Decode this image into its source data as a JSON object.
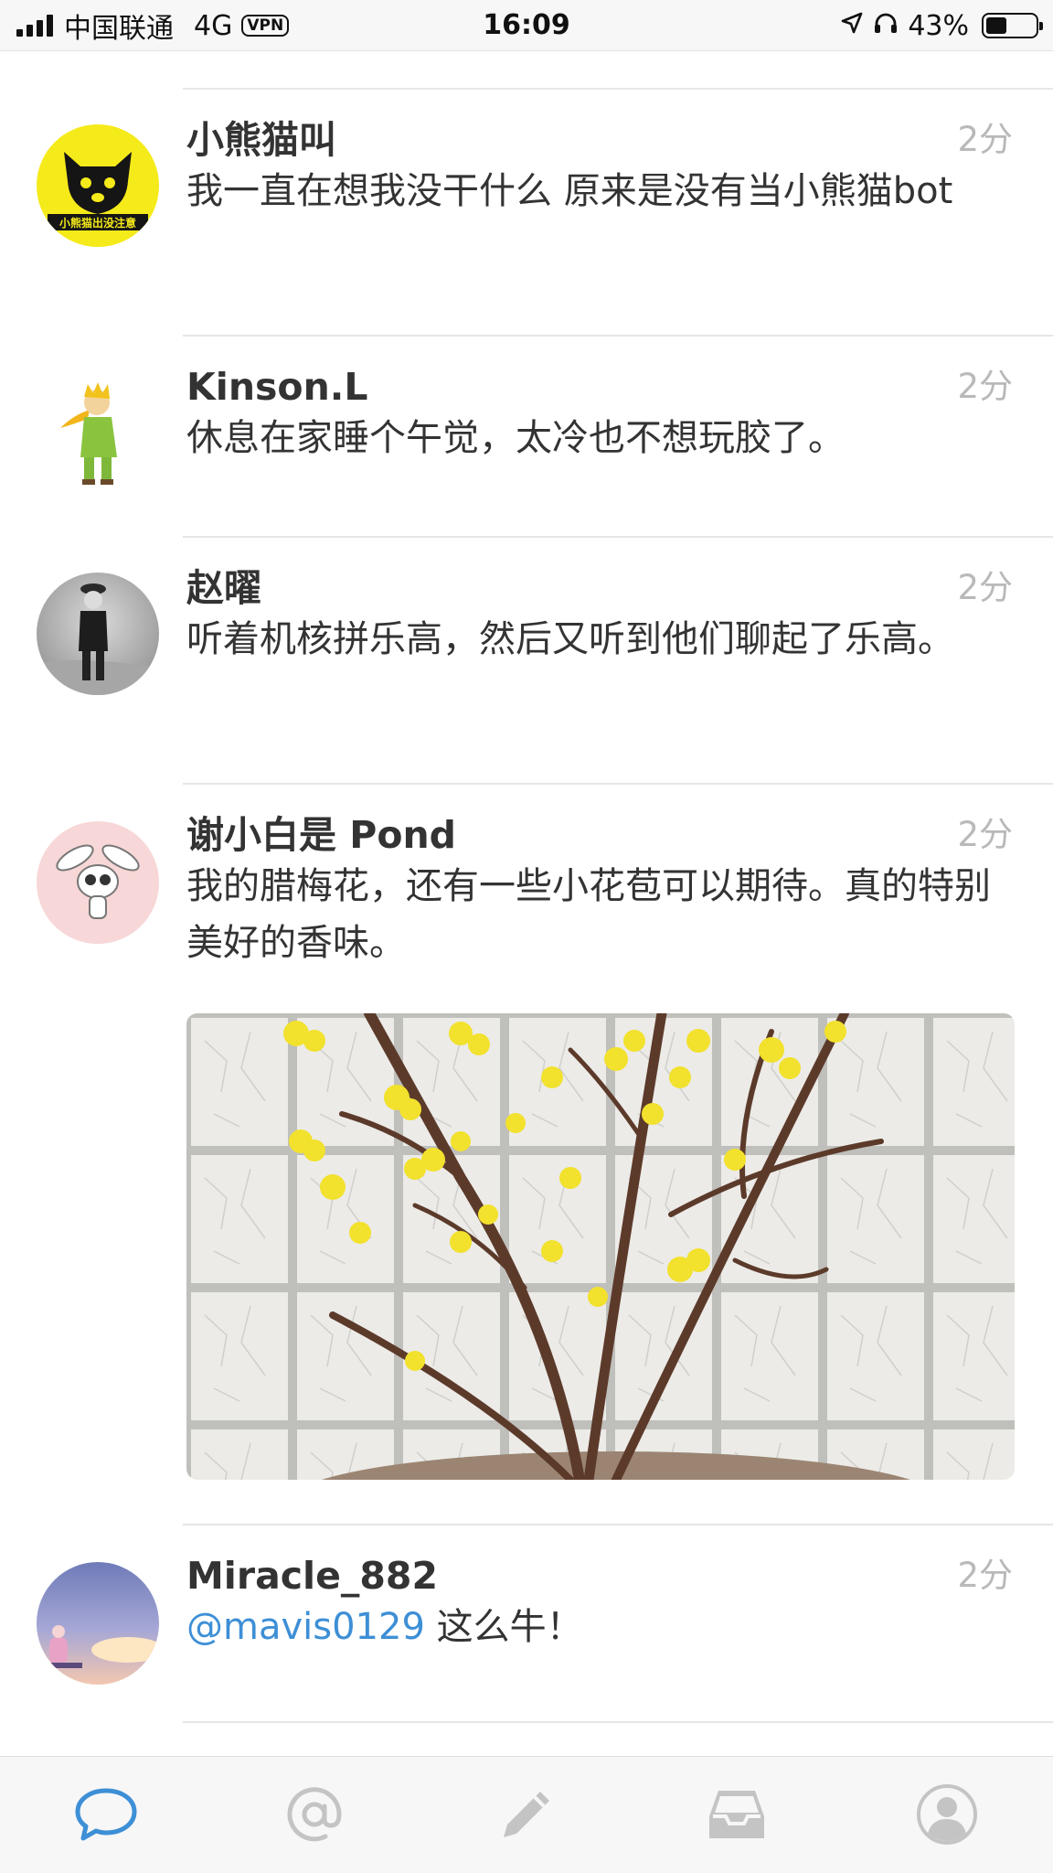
{
  "status_bar": {
    "carrier": "中国联通",
    "network": "4G",
    "vpn": "VPN",
    "time": "16:09",
    "battery": "43%",
    "battery_level": 0.43
  },
  "feed": {
    "posts": [
      {
        "author": "小熊猫叫",
        "time": "2分",
        "content": "我一直在想我没干什么 原来是没有当小熊猫bot",
        "avatar_icon": "red-panda-avatar",
        "avatar_text": "小熊猫出没注意"
      },
      {
        "author": "Kinson.L",
        "time": "2分",
        "content": "休息在家睡个午觉，太冷也不想玩胶了。",
        "avatar_icon": "little-prince-avatar"
      },
      {
        "author": "赵曜",
        "time": "2分",
        "content": "听着机核拼乐高，然后又听到他们聊起了乐高。",
        "avatar_icon": "vintage-photo-avatar"
      },
      {
        "author": "谢小白是 Pond",
        "time": "2分",
        "content": "我的腊梅花，还有一些小花苞可以期待。真的特别美好的香味。",
        "avatar_icon": "rabbit-avatar",
        "image": "wintersweet-photo"
      },
      {
        "author": "Miracle_882",
        "time": "2分",
        "mention": "@mavis0129",
        "content": " 这么牛！",
        "avatar_icon": "sunset-girl-avatar"
      }
    ]
  },
  "tab_bar": {
    "tabs": [
      "home-chat-icon",
      "mentions-at-icon",
      "compose-pencil-icon",
      "inbox-tray-icon",
      "profile-icon"
    ],
    "active_color": "#3d8fd6",
    "inactive_color": "#c4c4c4"
  }
}
